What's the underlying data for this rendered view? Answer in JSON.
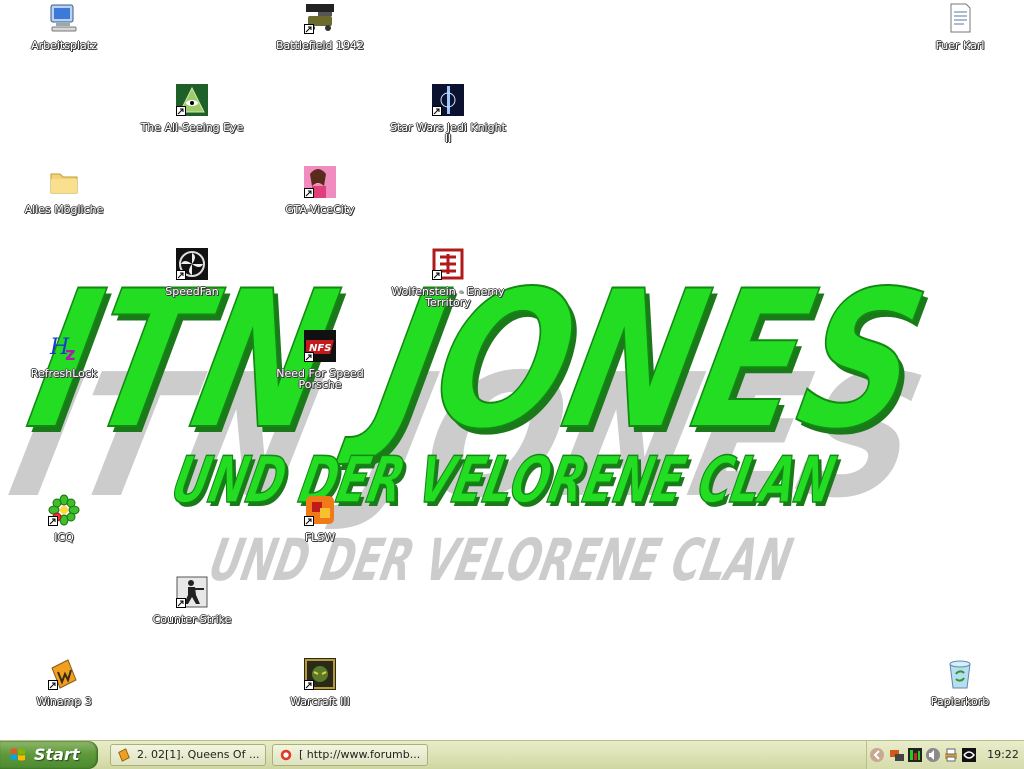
{
  "wallpaper": {
    "title": "ITN JONES",
    "subtitle": "UND DER VELORENE CLAN",
    "title_color": "#22dd22",
    "shadow_color": "#9a9a9a"
  },
  "desktop_icons": [
    {
      "id": "arbeitsplatz",
      "label": "Arbeitsplatz",
      "icon": "my-computer-icon",
      "shortcut": false
    },
    {
      "id": "battlefield",
      "label": "Battlefield 1942",
      "icon": "battlefield-icon",
      "shortcut": true
    },
    {
      "id": "fuer-karl",
      "label": "Fuer Karl",
      "icon": "text-document-icon",
      "shortcut": false
    },
    {
      "id": "all-seeing-eye",
      "label": "The All-Seeing Eye",
      "icon": "all-seeing-eye-icon",
      "shortcut": true
    },
    {
      "id": "jedi-knight",
      "label": "Star Wars Jedi Knight II",
      "icon": "jedi-knight-icon",
      "shortcut": true
    },
    {
      "id": "alles-moegliche",
      "label": "Alles Mögliche",
      "icon": "folder-icon",
      "shortcut": false
    },
    {
      "id": "gta",
      "label": "GTA-ViceCity",
      "icon": "gta-vicecity-icon",
      "shortcut": true
    },
    {
      "id": "speedfan",
      "label": "SpeedFan",
      "icon": "speedfan-icon",
      "shortcut": true
    },
    {
      "id": "wolfenstein",
      "label": "Wolfenstein - Enemy Territory",
      "icon": "wolfenstein-icon",
      "shortcut": true
    },
    {
      "id": "refreshlock",
      "label": "RefreshLock",
      "icon": "refreshlock-icon",
      "shortcut": false
    },
    {
      "id": "nfs",
      "label": "Need For Speed Porsche",
      "icon": "need-for-speed-icon",
      "shortcut": true
    },
    {
      "id": "icq",
      "label": "ICQ",
      "icon": "icq-flower-icon",
      "shortcut": true
    },
    {
      "id": "flsw",
      "label": "FLSW",
      "icon": "flsw-icon",
      "shortcut": true
    },
    {
      "id": "counter-strike",
      "label": "Counter-Strike",
      "icon": "counter-strike-icon",
      "shortcut": true
    },
    {
      "id": "winamp",
      "label": "Winamp 3",
      "icon": "winamp-icon",
      "shortcut": true
    },
    {
      "id": "warcraft",
      "label": "Warcraft III",
      "icon": "warcraft-icon",
      "shortcut": true
    },
    {
      "id": "papierkorb",
      "label": "Papierkorb",
      "icon": "recycle-bin-icon",
      "shortcut": false
    }
  ],
  "taskbar": {
    "start_label": "Start",
    "tasks": [
      {
        "label": "2. 02[1]. Queens Of ...",
        "icon": "winamp-icon"
      },
      {
        "label": "[ http://www.forumb...",
        "icon": "browser-icon"
      }
    ],
    "tray_icons": [
      "show-hidden-arrow-icon",
      "network-icon",
      "speedfan-tray-icon",
      "volume-icon",
      "printer-icon",
      "nvidia-icon"
    ],
    "clock": "19:22"
  },
  "colors": {
    "taskbar": "#dfe4b8",
    "start_button": "#5f9a3c",
    "desktop": "#ffffff"
  }
}
